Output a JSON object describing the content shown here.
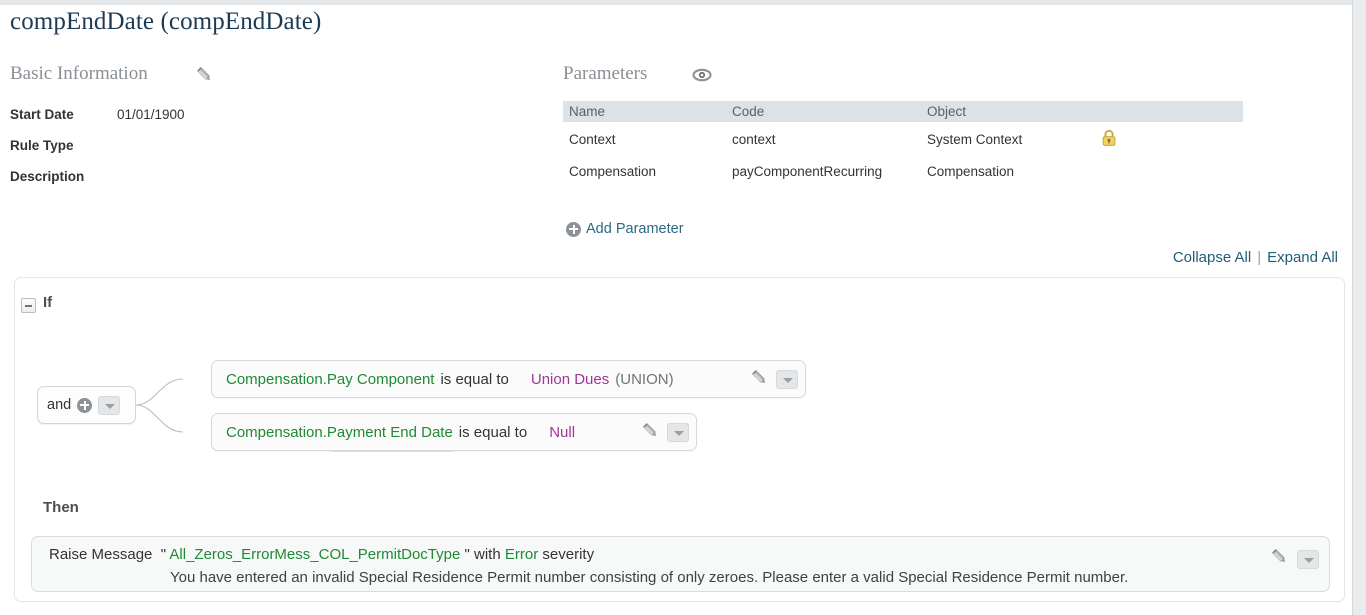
{
  "page": {
    "title": "compEndDate (compEndDate)"
  },
  "basic_information": {
    "heading": "Basic Information",
    "edit_icon": "pencil-icon",
    "fields": [
      {
        "label": "Start Date",
        "value": "01/01/1900"
      },
      {
        "label": "Rule Type",
        "value": ""
      },
      {
        "label": "Description",
        "value": ""
      }
    ]
  },
  "parameters": {
    "heading": "Parameters",
    "toggle_icon": "eye-icon",
    "columns": [
      "Name",
      "Code",
      "Object",
      ""
    ],
    "rows": [
      {
        "name": "Context",
        "code": "context",
        "object": "System Context",
        "locked": true,
        "lock_icon": "lock-icon"
      },
      {
        "name": "Compensation",
        "code": "payComponentRecurring",
        "object": "Compensation",
        "locked": false,
        "lock_icon": ""
      }
    ],
    "add_label": "Add Parameter",
    "add_icon": "circle-plus-icon"
  },
  "tree_controls": {
    "collapse_all": "Collapse All",
    "separator": "|",
    "expand_all": "Expand All"
  },
  "rule": {
    "if_label": "If",
    "then_label": "Then",
    "collapse_icon": "minus-box-icon",
    "operator": {
      "label": "and",
      "add_icon": "circle-plus-icon",
      "dropdown_icon": "chevron-down-icon"
    },
    "conditions": [
      {
        "field": "Compensation.Pay Component",
        "operator": "is equal to",
        "value": "Union Dues",
        "value_code": "(UNION)",
        "highlighted": false,
        "edit_icon": "pencil-icon",
        "dropdown_icon": "chevron-down-icon"
      },
      {
        "field_prefix": "Compensation.",
        "field_highlight": "Payment End Date",
        "field": "Compensation.Payment End Date",
        "operator": "is equal to",
        "value": "Null",
        "value_code": "",
        "highlighted": true,
        "edit_icon": "pencil-icon",
        "dropdown_icon": "chevron-down-icon"
      }
    ],
    "action": {
      "verb": "Raise Message",
      "quote_open": "\"",
      "message_key": "All_Zeros_ErrorMess_COL_PermitDocType",
      "quote_close": "\"",
      "with_label": "with",
      "severity": "Error",
      "severity_suffix": "severity",
      "message_text": "You have entered an invalid Special Residence Permit number consisting of only zeroes. Please enter a valid Special Residence Permit number.",
      "edit_icon": "pencil-icon",
      "dropdown_icon": "chevron-down-icon"
    }
  },
  "colors": {
    "title": "#1b3a54",
    "field_green": "#1f8a34",
    "value_purple": "#a2359b",
    "link_blue": "#1d5f77",
    "highlight_yellow": "#fbfb18",
    "table_header_bg": "#dde2e7"
  }
}
